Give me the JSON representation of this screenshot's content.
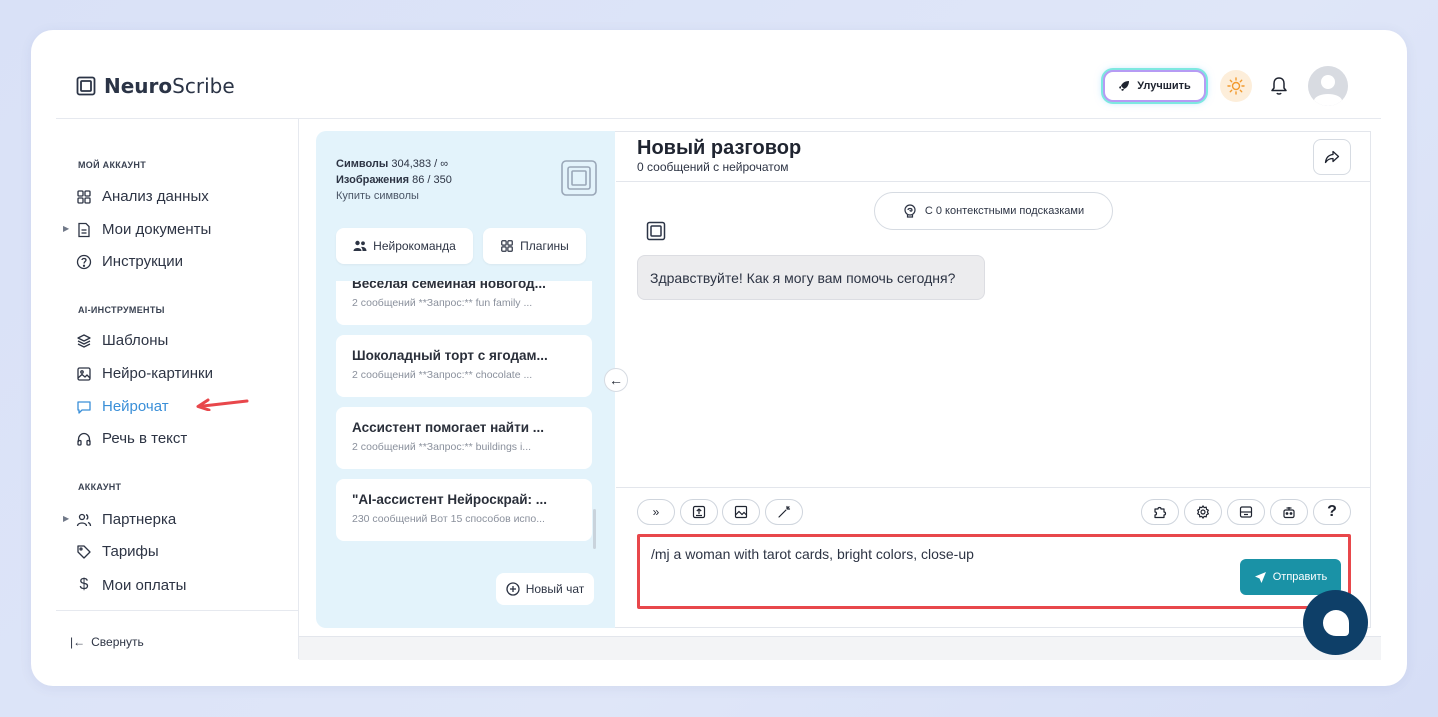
{
  "app": {
    "logo_bold": "Neuro",
    "logo_rest": "Scribe"
  },
  "header": {
    "upgrade_label": "Улучшить"
  },
  "sidebar": {
    "section_account": "МОЙ АККАУНТ",
    "section_ai": "AI-ИНСТРУМЕНТЫ",
    "section_acc2": "АККАУНТ",
    "items": [
      {
        "label": "Анализ данных"
      },
      {
        "label": "Мои документы"
      },
      {
        "label": "Инструкции"
      },
      {
        "label": "Шаблоны"
      },
      {
        "label": "Нейро-картинки"
      },
      {
        "label": "Нейрочат"
      },
      {
        "label": "Речь в текст"
      },
      {
        "label": "Партнерка"
      },
      {
        "label": "Тарифы"
      },
      {
        "label": "Мои оплаты"
      }
    ],
    "collapse_label": "Свернуть"
  },
  "stats": {
    "symbols_label": "Символы",
    "symbols_value": "304,383 / ∞",
    "images_label": "Изображения",
    "images_value": "86 / 350",
    "buy_label": "Купить символы"
  },
  "chatlist": {
    "team_label": "Нейрокоманда",
    "plugins_label": "Плагины",
    "chats": [
      {
        "title": "Веселая семейная новогод...",
        "sub": "2 сообщений    **Запрос:** fun family ..."
      },
      {
        "title": "Шоколадный торт с ягодам...",
        "sub": "2 сообщений    **Запрос:** chocolate ..."
      },
      {
        "title": "Ассистент помогает найти ...",
        "sub": "2 сообщений    **Запрос:** buildings i..."
      },
      {
        "title": "\"AI-ассистент Нейроскрай: ...",
        "sub": "230 сообщений Вот 15 способов испо..."
      }
    ],
    "new_chat_label": "Новый чат"
  },
  "chat": {
    "title": "Новый разговор",
    "subtitle": "0 сообщений с нейрочатом",
    "context_label": "С 0 контекстными подсказками",
    "bot_message": "Здравствуйте! Как я могу вам помочь сегодня?",
    "input_value": "/mj a woman with tarot cards, bright colors, close-up",
    "send_label": "Отправить",
    "help_symbol": "?"
  },
  "colors": {
    "accent": "#3a8fd8",
    "send": "#1a92a6",
    "highlight": "#e8474b",
    "fab": "#0e3f68"
  }
}
